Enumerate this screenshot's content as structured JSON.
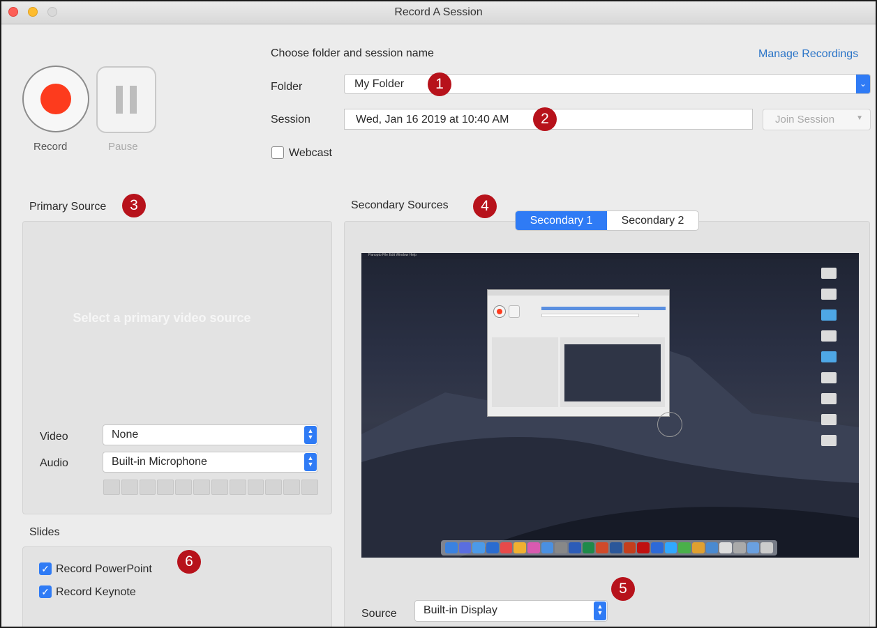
{
  "window": {
    "title": "Record A Session"
  },
  "controls": {
    "record_label": "Record",
    "pause_label": "Pause"
  },
  "session_settings": {
    "heading": "Choose folder and session name",
    "manage_link": "Manage Recordings",
    "folder_label": "Folder",
    "folder_value": "My Folder",
    "session_label": "Session",
    "session_value": "Wed, Jan 16 2019 at 10:40 AM",
    "join_label": "Join Session",
    "webcast_label": "Webcast",
    "webcast_checked": false
  },
  "primary": {
    "heading": "Primary Source",
    "placeholder": "Select a primary video source",
    "video_label": "Video",
    "video_value": "None",
    "audio_label": "Audio",
    "audio_value": "Built-in Microphone"
  },
  "secondary": {
    "heading": "Secondary Sources",
    "tabs": [
      {
        "label": "Secondary 1",
        "active": true
      },
      {
        "label": "Secondary 2",
        "active": false
      }
    ],
    "source_label": "Source",
    "source_value": "Built-in Display",
    "preview_menu": "Panopto File Edit Window Help"
  },
  "slides": {
    "heading": "Slides",
    "items": [
      {
        "label": "Record PowerPoint",
        "checked": true
      },
      {
        "label": "Record Keynote",
        "checked": true
      }
    ]
  },
  "badges": [
    "1",
    "2",
    "3",
    "4",
    "5",
    "6"
  ],
  "colors": {
    "accent": "#2f7bf5",
    "record": "#fd3b1d",
    "badge": "#b7121b",
    "link": "#2a74c7"
  }
}
